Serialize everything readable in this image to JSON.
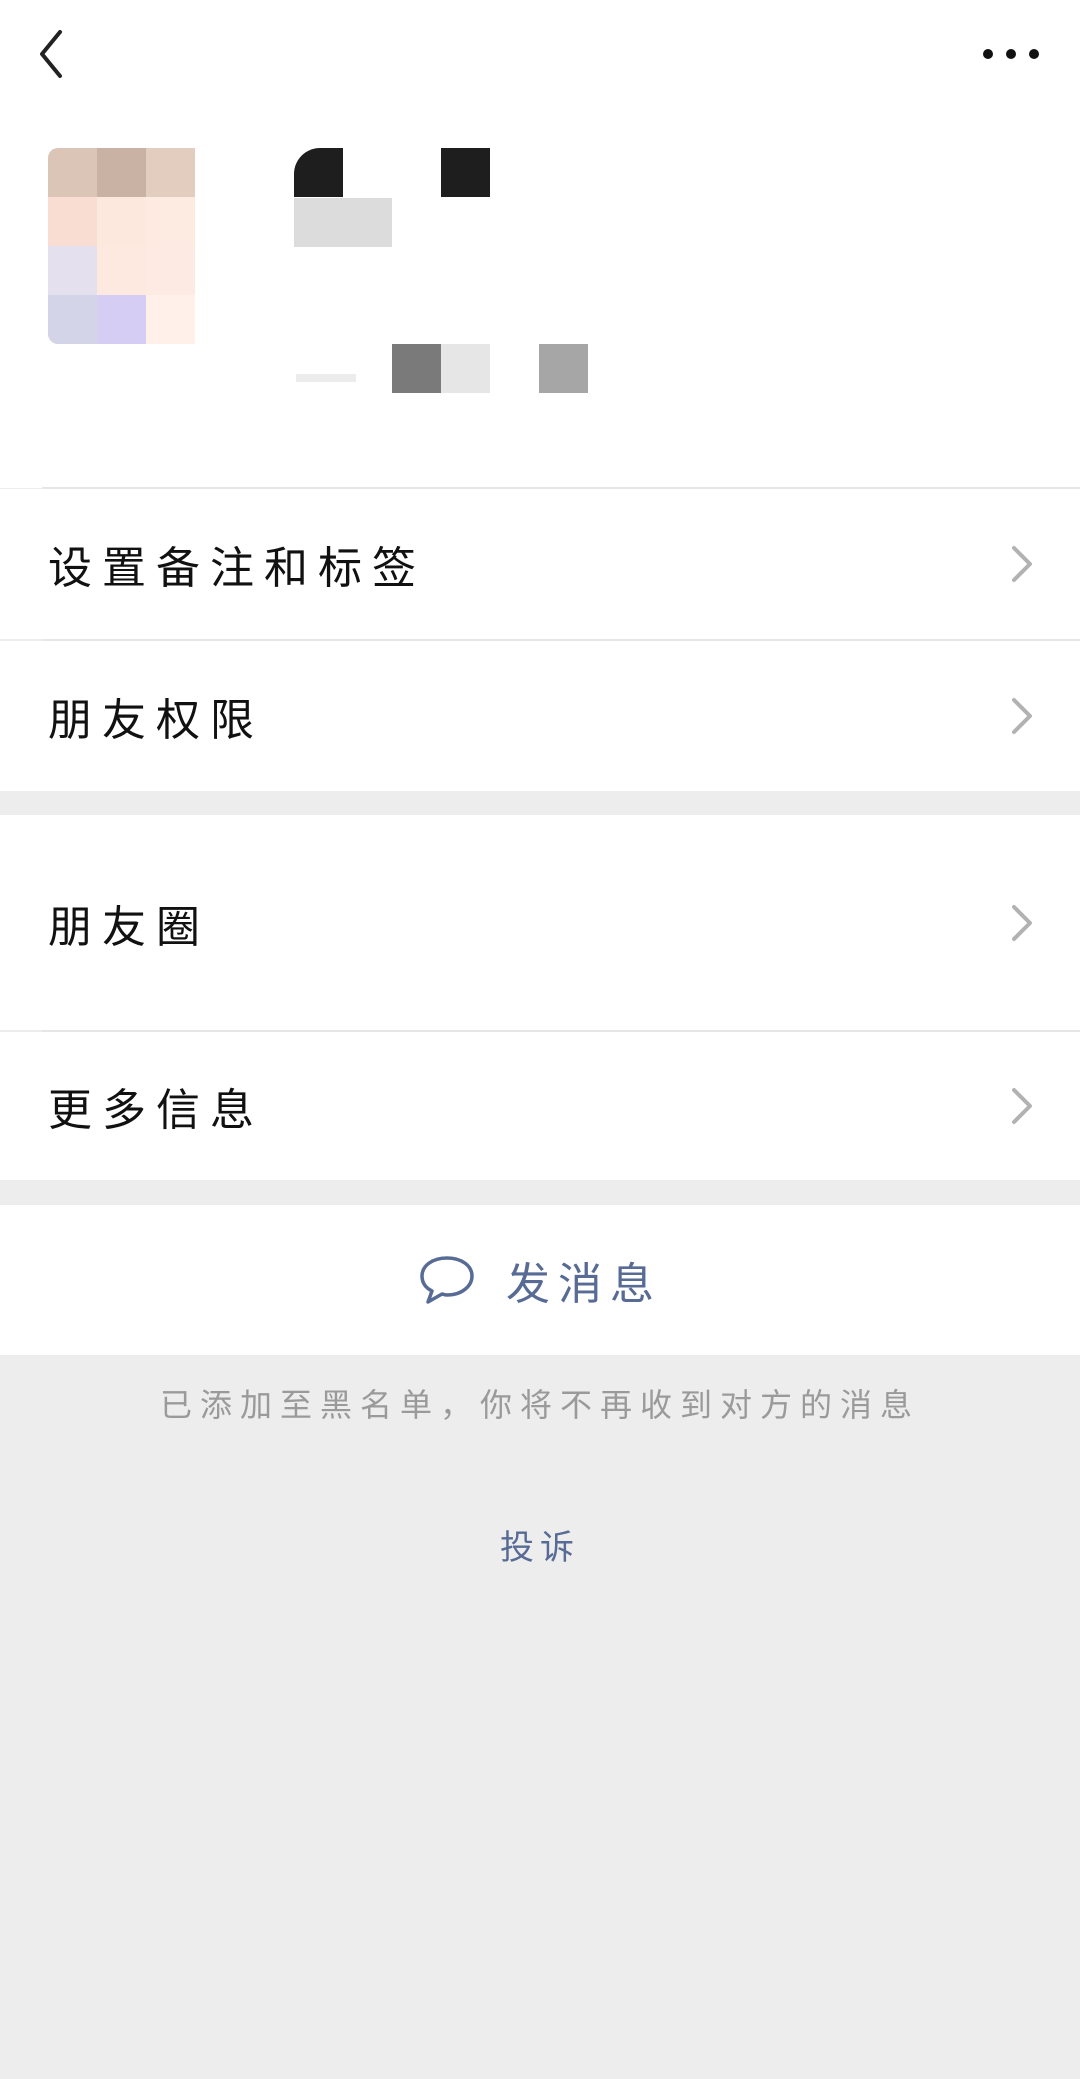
{
  "topbar": {
    "back_icon": "chevron-left-icon",
    "more_icon": "more-horizontal-icon"
  },
  "menu": {
    "set_remark_tags": "设置备注和标签",
    "friend_permissions": "朋友权限",
    "moments": "朋友圈",
    "more_info": "更多信息"
  },
  "actions": {
    "send_message": "发消息",
    "send_message_icon": "chat-bubble-icon"
  },
  "blacklist_hint": "已添加至黑名单，你将不再收到对方的消息",
  "complain_label": "投诉",
  "colors": {
    "link_blue": "#576b95",
    "background": "#ededed",
    "card": "#ffffff",
    "hint_gray": "#9a9a9a"
  }
}
